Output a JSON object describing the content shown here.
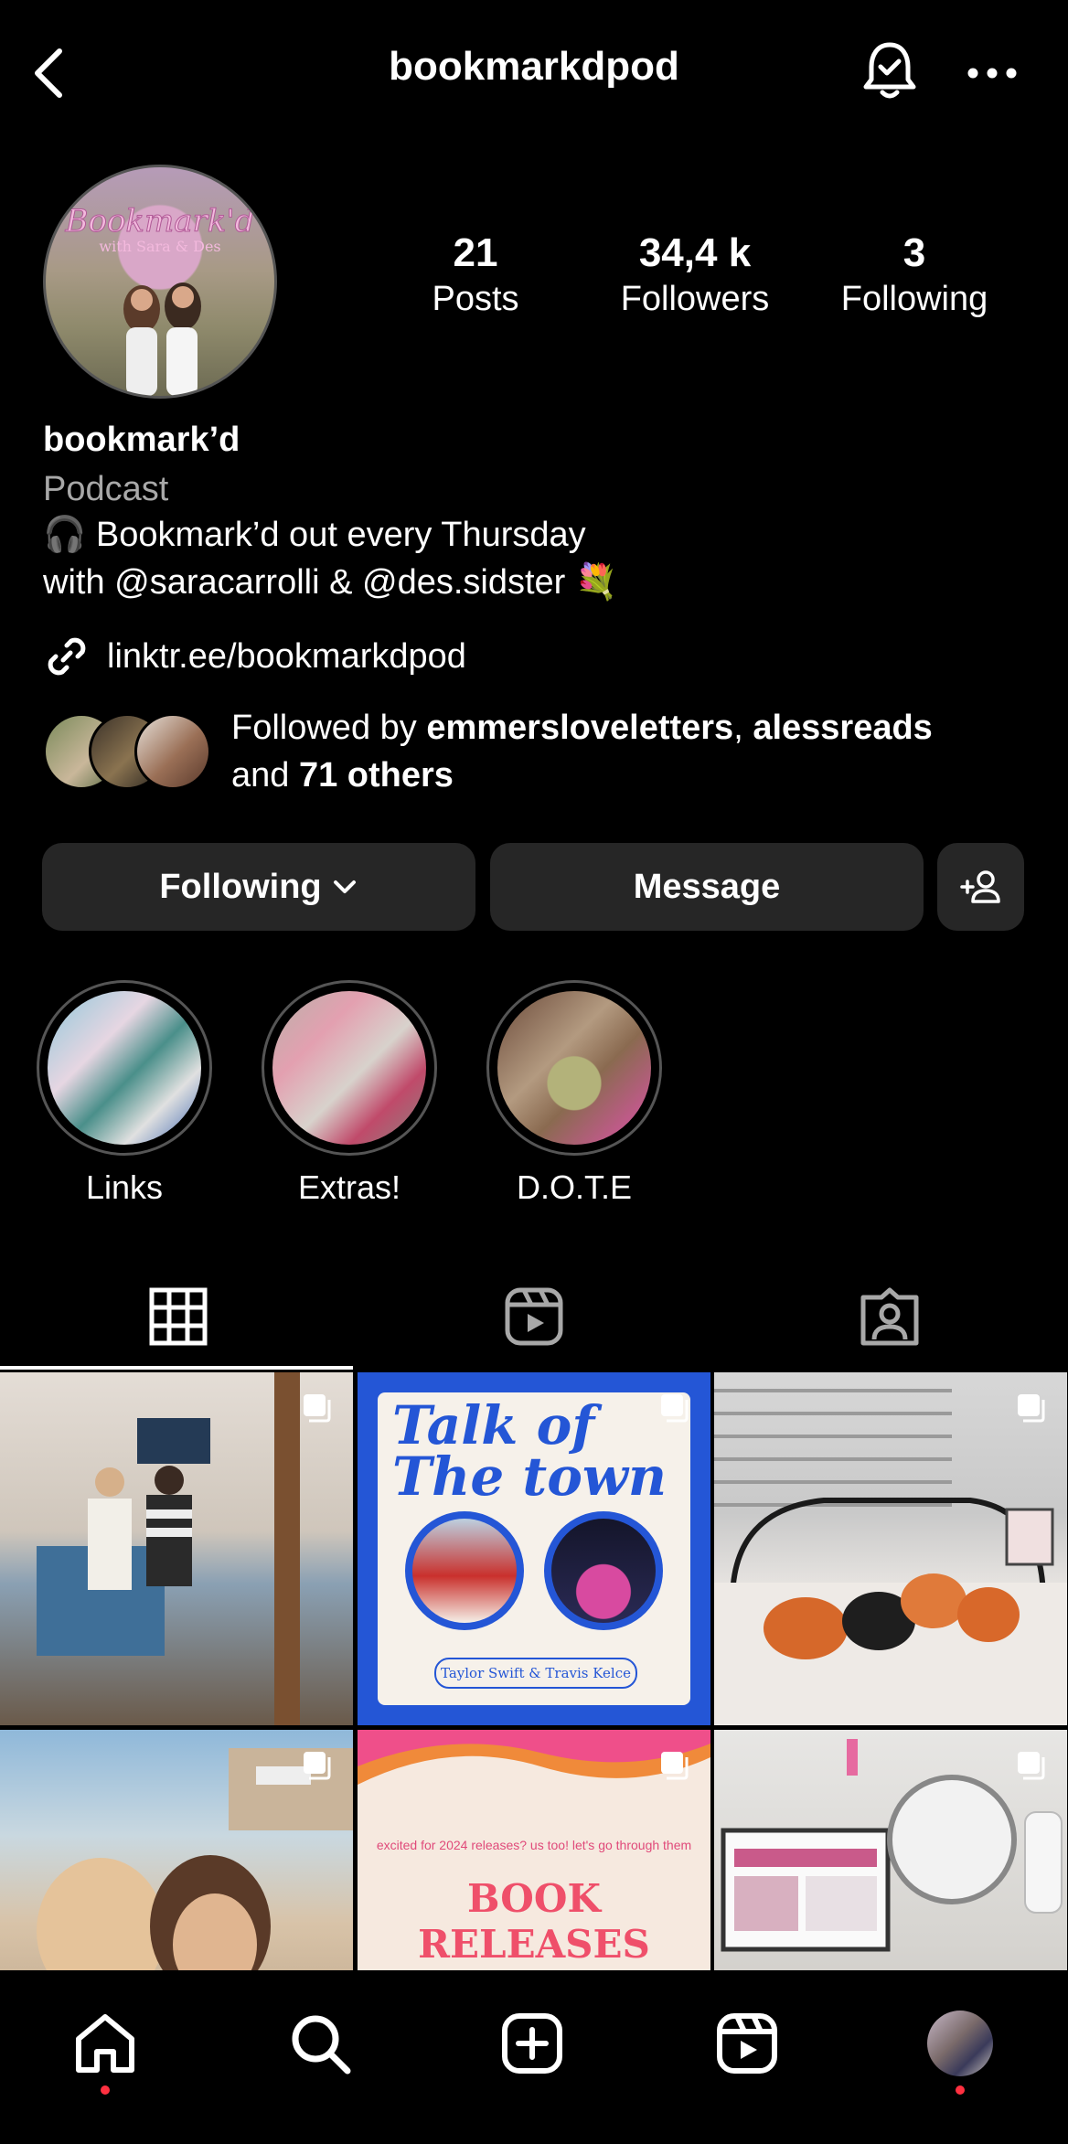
{
  "header": {
    "title": "bookmarkdpod"
  },
  "profile": {
    "stats": [
      {
        "value": "21",
        "label": "Posts"
      },
      {
        "value": "34,4 k",
        "label": "Followers"
      },
      {
        "value": "3",
        "label": "Following"
      }
    ],
    "name": "bookmark’d",
    "category": "Podcast",
    "bio_line1": "🎧 Bookmark’d out every Thursday",
    "bio_line2": "with @saracarrolli & @des.sidster 💐",
    "link": "linktr.ee/bookmarkdpod",
    "followed_by": {
      "prefix": "Followed by ",
      "user1": "emmersloveletters",
      "sep": ", ",
      "user2": "alessreads",
      "and": "and ",
      "others": "71 others"
    }
  },
  "actions": {
    "following_label": "Following",
    "message_label": "Message"
  },
  "highlights": [
    {
      "label": "Links"
    },
    {
      "label": "Extras!"
    },
    {
      "label": "D.O.T.E"
    }
  ],
  "posts": {
    "talk_title_1": "Talk of",
    "talk_title_2": "The town",
    "talk_caption": "Taylor Swift & Travis Kelce",
    "book_small": "excited for 2024 releases? us too! let's go through them",
    "book_title_1": "BOOK",
    "book_title_2": "RELEASES"
  },
  "colors": {
    "background": "#000000",
    "button_bg": "#262626",
    "notification_dot": "#ff3040",
    "post_blue": "#2456d6"
  }
}
